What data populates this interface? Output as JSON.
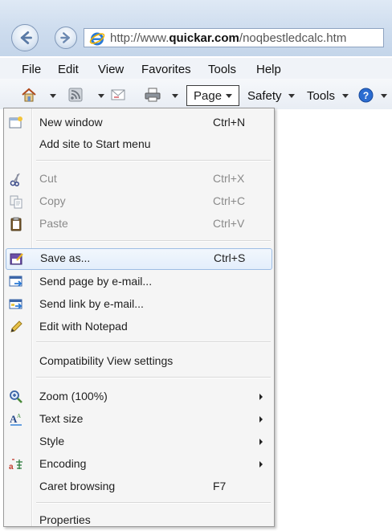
{
  "browser": {
    "url_prefix": "http://www.",
    "url_domain": "quickar.com",
    "url_path": "/noqbestledcalc.htm"
  },
  "menubar": [
    "File",
    "Edit",
    "View",
    "Favorites",
    "Tools",
    "Help"
  ],
  "commandbar": {
    "page": "Page",
    "safety": "Safety",
    "tools": "Tools"
  },
  "page_menu": {
    "items": [
      {
        "label": "New window",
        "shortcut": "Ctrl+N",
        "icon": "new-window-icon"
      },
      {
        "label": "Add site to Start menu",
        "shortcut": ""
      },
      {
        "label": "Cut",
        "shortcut": "Ctrl+X",
        "icon": "scissors-icon",
        "disabled": true
      },
      {
        "label": "Copy",
        "shortcut": "Ctrl+C",
        "icon": "copy-icon",
        "disabled": true
      },
      {
        "label": "Paste",
        "shortcut": "Ctrl+V",
        "icon": "clipboard-icon",
        "disabled": true
      },
      {
        "label": "Save as...",
        "shortcut": "Ctrl+S",
        "icon": "save-as-icon",
        "highlighted": true
      },
      {
        "label": "Send page by e-mail...",
        "shortcut": "",
        "icon": "send-page-icon"
      },
      {
        "label": "Send link by e-mail...",
        "shortcut": "",
        "icon": "send-link-icon"
      },
      {
        "label": "Edit with Notepad",
        "shortcut": "",
        "icon": "pencil-icon"
      },
      {
        "label": "Compatibility View settings",
        "shortcut": ""
      },
      {
        "label": "Zoom (100%)",
        "shortcut": "",
        "icon": "zoom-icon",
        "submenu": true
      },
      {
        "label": "Text size",
        "shortcut": "",
        "icon": "text-size-icon",
        "submenu": true
      },
      {
        "label": "Style",
        "shortcut": "",
        "submenu": true
      },
      {
        "label": "Encoding",
        "shortcut": "",
        "icon": "encoding-icon",
        "submenu": true
      },
      {
        "label": "Caret browsing",
        "shortcut": "F7"
      },
      {
        "label": "Properties",
        "shortcut": ""
      }
    ]
  }
}
